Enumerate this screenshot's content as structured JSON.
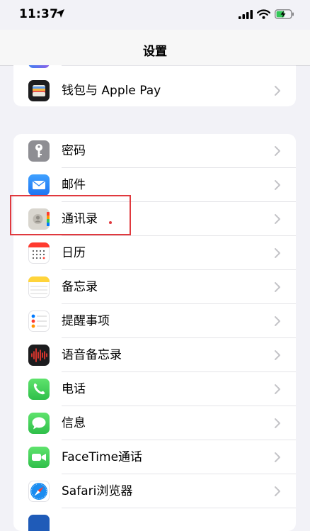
{
  "status_bar": {
    "time": "11:37"
  },
  "nav": {
    "title": "设置"
  },
  "group1": [
    {
      "label": "钱包与 Apple Pay",
      "icon": "wallet-icon"
    }
  ],
  "group2": [
    {
      "label": "密码",
      "icon": "key-icon"
    },
    {
      "label": "邮件",
      "icon": "mail-icon"
    },
    {
      "label": "通讯录",
      "icon": "contacts-icon"
    },
    {
      "label": "日历",
      "icon": "calendar-icon"
    },
    {
      "label": "备忘录",
      "icon": "notes-icon"
    },
    {
      "label": "提醒事项",
      "icon": "reminders-icon"
    },
    {
      "label": "语音备忘录",
      "icon": "voice-memos-icon"
    },
    {
      "label": "电话",
      "icon": "phone-icon"
    },
    {
      "label": "信息",
      "icon": "messages-icon"
    },
    {
      "label": "FaceTime通话",
      "icon": "facetime-icon"
    },
    {
      "label": "Safari浏览器",
      "icon": "safari-icon"
    }
  ],
  "colors": {
    "highlight": "#e0393e",
    "background": "#f2f2f7"
  }
}
